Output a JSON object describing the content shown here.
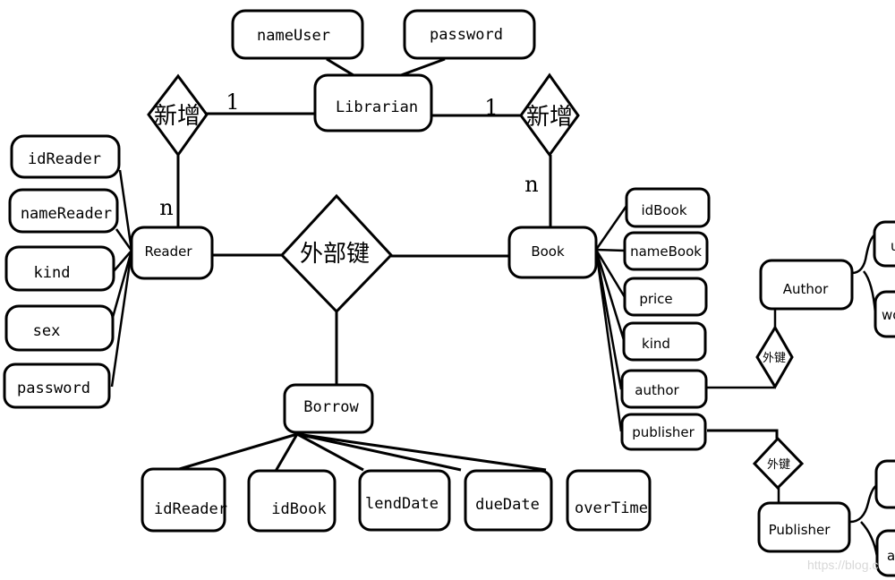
{
  "diagram": {
    "type": "er-diagram",
    "entities": {
      "librarian": {
        "label": "Librarian",
        "attributes": [
          "nameUser",
          "password"
        ]
      },
      "reader": {
        "label": "Reader",
        "attributes": [
          "idReader",
          "nameReader",
          "kind",
          "sex",
          "password"
        ]
      },
      "book": {
        "label": "Book",
        "attributes": [
          "idBook",
          "nameBook",
          "price",
          "kind",
          "author",
          "publisher"
        ]
      },
      "borrow": {
        "label": "Borrow",
        "attributes": [
          "idReader",
          "idBook",
          "lendDate",
          "dueDate",
          "overTime"
        ]
      },
      "author": {
        "label": "Author",
        "attributes": [
          "u",
          "wo"
        ]
      },
      "publisher": {
        "label": "Publisher",
        "attributes": [
          "",
          "a"
        ]
      }
    },
    "relationships": {
      "add_reader": {
        "label": "新增",
        "from": "Librarian",
        "to": "Reader",
        "card_from": "1",
        "card_to": "n"
      },
      "add_book": {
        "label": "新增",
        "from": "Librarian",
        "to": "Book",
        "card_from": "1",
        "card_to": "n"
      },
      "foreign_key_main": {
        "label": "外部键",
        "links": [
          "Reader",
          "Book",
          "Borrow"
        ]
      },
      "foreign_key_author": {
        "label": "外键",
        "links": [
          "author",
          "Author"
        ]
      },
      "foreign_key_publisher": {
        "label": "外键",
        "links": [
          "publisher",
          "Publisher"
        ]
      }
    },
    "watermark": "https://blog.c"
  }
}
